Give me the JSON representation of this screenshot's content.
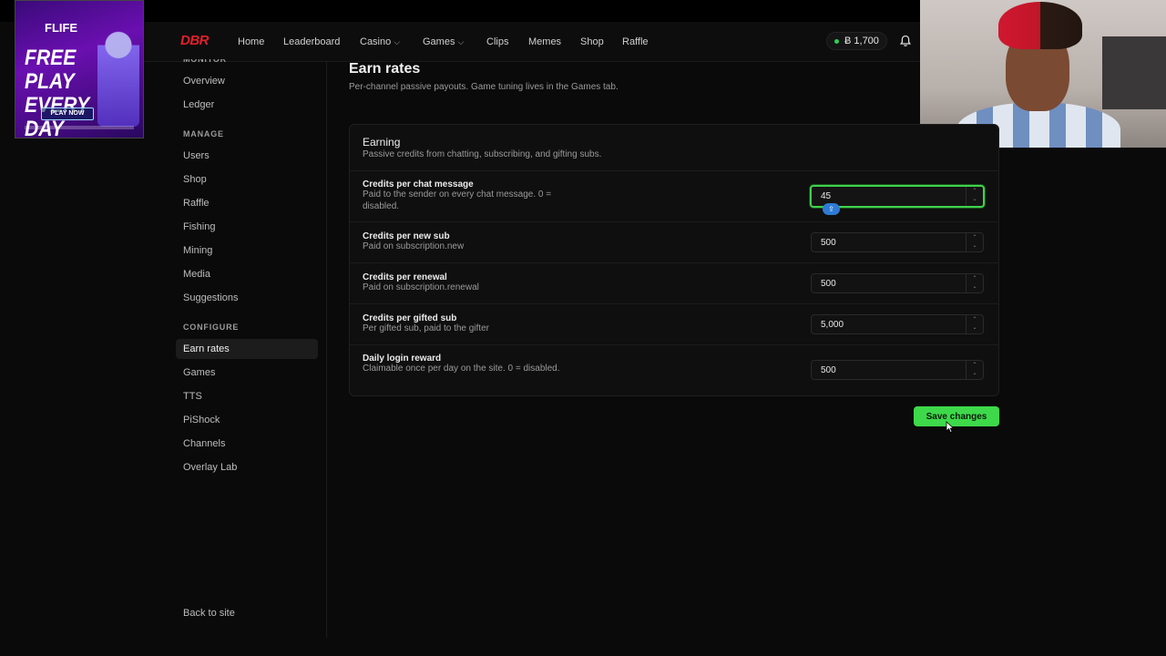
{
  "ad": {
    "brand": "FLIFE",
    "headline": "FREE PLAY EVERY DAY",
    "cta": "PLAY NOW"
  },
  "nav": {
    "logo": "DBR",
    "items": [
      "Home",
      "Leaderboard",
      "Casino",
      "Games",
      "Clips",
      "Memes",
      "Shop",
      "Raffle"
    ],
    "balance": "Ƀ 1,700"
  },
  "sidebar": {
    "monitor_title": "MONITOR",
    "monitor_items": [
      "Overview",
      "Ledger"
    ],
    "manage_title": "MANAGE",
    "manage_items": [
      "Users",
      "Shop",
      "Raffle",
      "Fishing",
      "Mining",
      "Media",
      "Suggestions"
    ],
    "configure_title": "CONFIGURE",
    "configure_items": [
      "Earn rates",
      "Games",
      "TTS",
      "PiShock",
      "Channels",
      "Overlay Lab"
    ],
    "back": "Back to site"
  },
  "page": {
    "title": "Earn rates",
    "subtitle": "Per-channel passive payouts. Game tuning lives in the Games tab."
  },
  "card": {
    "title": "Earning",
    "subtitle": "Passive credits from chatting, subscribing, and gifting subs.",
    "rows": [
      {
        "label": "Credits per chat message",
        "help": "Paid to the sender on every chat message. 0 = disabled.",
        "value": "45"
      },
      {
        "label": "Credits per new sub",
        "help": "Paid on subscription.new",
        "value": "500"
      },
      {
        "label": "Credits per renewal",
        "help": "Paid on subscription.renewal",
        "value": "500"
      },
      {
        "label": "Credits per gifted sub",
        "help": "Per gifted sub, paid to the gifter",
        "value": "5,000"
      },
      {
        "label": "Daily login reward",
        "help": "Claimable once per day on the site. 0 = disabled.",
        "value": "500"
      }
    ]
  },
  "actions": {
    "save": "Save changes"
  },
  "colors": {
    "accent_green": "#3ed94a",
    "brand_red": "#e0202a",
    "background": "#0a0a0a"
  }
}
